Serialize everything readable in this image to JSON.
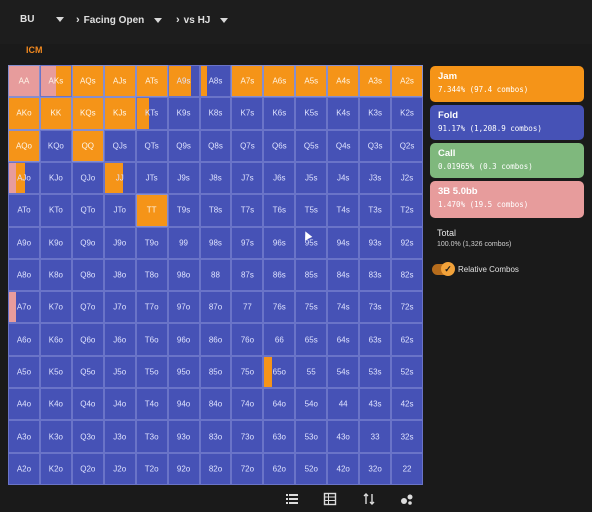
{
  "header": {
    "position_label": "BU",
    "action_label": "Facing Open",
    "vs_label": "vs HJ"
  },
  "icm_label": "ICM",
  "grid": {
    "rows": [
      [
        "AA",
        "AKs",
        "AQs",
        "AJs",
        "ATs",
        "A9s",
        "A8s",
        "A7s",
        "A6s",
        "A5s",
        "A4s",
        "A3s",
        "A2s"
      ],
      [
        "AKo",
        "KK",
        "KQs",
        "KJs",
        "KTs",
        "K9s",
        "K8s",
        "K7s",
        "K6s",
        "K5s",
        "K4s",
        "K3s",
        "K2s"
      ],
      [
        "AQo",
        "KQo",
        "QQ",
        "QJs",
        "QTs",
        "Q9s",
        "Q8s",
        "Q7s",
        "Q6s",
        "Q5s",
        "Q4s",
        "Q3s",
        "Q2s"
      ],
      [
        "AJo",
        "KJo",
        "QJo",
        "JJ",
        "JTs",
        "J9s",
        "J8s",
        "J7s",
        "J6s",
        "J5s",
        "J4s",
        "J3s",
        "J2s"
      ],
      [
        "ATo",
        "KTo",
        "QTo",
        "JTo",
        "TT",
        "T9s",
        "T8s",
        "T7s",
        "T6s",
        "T5s",
        "T4s",
        "T3s",
        "T2s"
      ],
      [
        "A9o",
        "K9o",
        "Q9o",
        "J9o",
        "T9o",
        "99",
        "98s",
        "97s",
        "96s",
        "95s",
        "94s",
        "93s",
        "92s"
      ],
      [
        "A8o",
        "K8o",
        "Q8o",
        "J8o",
        "T8o",
        "98o",
        "88",
        "87s",
        "86s",
        "85s",
        "84s",
        "83s",
        "82s"
      ],
      [
        "A7o",
        "K7o",
        "Q7o",
        "J7o",
        "T7o",
        "97o",
        "87o",
        "77",
        "76s",
        "75s",
        "74s",
        "73s",
        "72s"
      ],
      [
        "A6o",
        "K6o",
        "Q6o",
        "J6o",
        "T6o",
        "96o",
        "86o",
        "76o",
        "66",
        "65s",
        "64s",
        "63s",
        "62s"
      ],
      [
        "A5o",
        "K5o",
        "Q5o",
        "J5o",
        "T5o",
        "95o",
        "85o",
        "75o",
        "65o",
        "55",
        "54s",
        "53s",
        "52s"
      ],
      [
        "A4o",
        "K4o",
        "Q4o",
        "J4o",
        "T4o",
        "94o",
        "84o",
        "74o",
        "64o",
        "54o",
        "44",
        "43s",
        "42s"
      ],
      [
        "A3o",
        "K3o",
        "Q3o",
        "J3o",
        "T3o",
        "93o",
        "83o",
        "73o",
        "63o",
        "53o",
        "43o",
        "33",
        "32s"
      ],
      [
        "A2o",
        "K2o",
        "Q2o",
        "J2o",
        "T2o",
        "92o",
        "82o",
        "72o",
        "62o",
        "52o",
        "42o",
        "32o",
        "22"
      ]
    ],
    "mixes": {
      "AA": {
        "threebet": 1.0
      },
      "AKs": {
        "threebet": 0.5,
        "jam": 0.5
      },
      "AQs": {
        "jam": 1.0
      },
      "AJs": {
        "jam": 1.0
      },
      "ATs": {
        "jam": 1.0
      },
      "A9s": {
        "jam": 0.75,
        "fold": 0.25
      },
      "A8s": {
        "fold": 0.8,
        "jam": 0.2
      },
      "A7s": {
        "jam": 1.0
      },
      "A6s": {
        "jam": 1.0
      },
      "A5s": {
        "jam": 1.0
      },
      "A4s": {
        "jam": 1.0
      },
      "A3s": {
        "jam": 1.0
      },
      "A2s": {
        "jam": 1.0
      },
      "AKo": {
        "jam": 1.0
      },
      "KK": {
        "jam": 1.0
      },
      "KQs": {
        "jam": 1.0
      },
      "KJs": {
        "jam": 1.0
      },
      "KTs": {
        "jam": 0.4,
        "fold": 0.6
      },
      "AQo": {
        "jam": 1.0
      },
      "QQ": {
        "jam": 1.0
      },
      "AJo": {
        "fold": 0.45,
        "threebet": 0.25,
        "jam": 0.3
      },
      "JJ": {
        "fold": 0.4,
        "jam": 0.6
      },
      "TT": {
        "jam": 1.0
      },
      "A7o": {
        "fold": 0.75,
        "threebet": 0.25
      },
      "65o": {
        "fold": 0.75,
        "jam": 0.25
      }
    }
  },
  "legend": [
    {
      "key": "jam",
      "name": "Jam",
      "value": "7.344% (97.4 combos)",
      "color": "#f59418"
    },
    {
      "key": "fold",
      "name": "Fold",
      "value": "91.17% (1,208.9 combos)",
      "color": "#4652b6"
    },
    {
      "key": "call",
      "name": "Call",
      "value": "0.01965% (0.3 combos)",
      "color": "#7fb87d"
    },
    {
      "key": "threebet",
      "name": "3B 5.0bb",
      "value": "1.470% (19.5 combos)",
      "color": "#e79c9c"
    }
  ],
  "total": {
    "title": "Total",
    "value": "100.0% (1,326 combos)"
  },
  "toggle": {
    "label": "Relative Combos",
    "on": true
  },
  "toolbar": [
    "list-icon",
    "table-icon",
    "sort-icon",
    "bubbles-icon"
  ]
}
